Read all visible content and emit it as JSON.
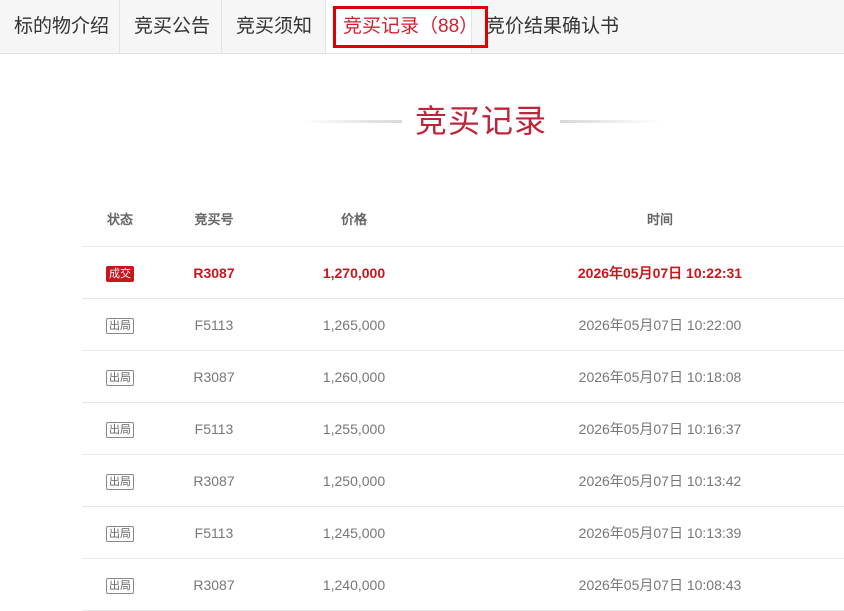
{
  "tabs": [
    {
      "label": "标的物介绍"
    },
    {
      "label": "竞买公告"
    },
    {
      "label": "竞买须知"
    },
    {
      "label": "竞买记录",
      "count_text": "（88）"
    },
    {
      "label": "竞价结果确认书"
    }
  ],
  "active_tab_index": 3,
  "section_title": "竞买记录",
  "table": {
    "headers": {
      "status": "状态",
      "bid_no": "竞买号",
      "price": "价格",
      "time": "时间"
    },
    "rows": [
      {
        "status": "成交",
        "bid_no": "R3087",
        "price": "1,270,000",
        "time": "2026年05月07日 10:22:31"
      },
      {
        "status": "出局",
        "bid_no": "F5113",
        "price": "1,265,000",
        "time": "2026年05月07日 10:22:00"
      },
      {
        "status": "出局",
        "bid_no": "R3087",
        "price": "1,260,000",
        "time": "2026年05月07日 10:18:08"
      },
      {
        "status": "出局",
        "bid_no": "F5113",
        "price": "1,255,000",
        "time": "2026年05月07日 10:16:37"
      },
      {
        "status": "出局",
        "bid_no": "R3087",
        "price": "1,250,000",
        "time": "2026年05月07日 10:13:42"
      },
      {
        "status": "出局",
        "bid_no": "F5113",
        "price": "1,245,000",
        "time": "2026年05月07日 10:13:39"
      },
      {
        "status": "出局",
        "bid_no": "R3087",
        "price": "1,240,000",
        "time": "2026年05月07日 10:08:43"
      }
    ]
  },
  "colors": {
    "accent": "#c0243a",
    "win": "#c8161d",
    "highlight_box": "#e00000"
  }
}
